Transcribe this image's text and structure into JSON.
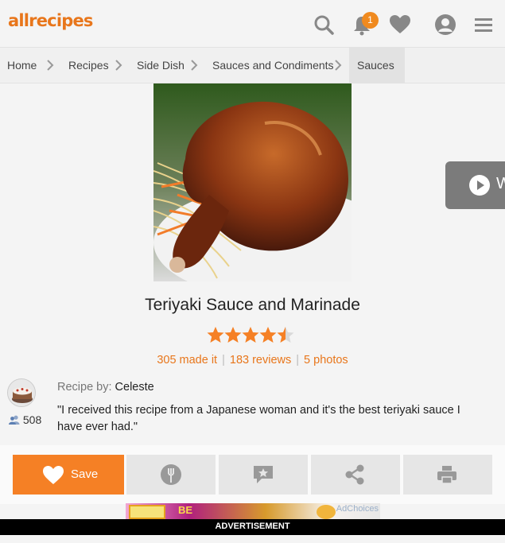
{
  "header": {
    "logo_text": "allrecipes",
    "notification_count": "1",
    "icons": [
      "search-icon",
      "bell-icon",
      "heart-icon",
      "user-icon",
      "hamburger-menu-icon"
    ]
  },
  "breadcrumb": {
    "items": [
      "Home",
      "Recipes",
      "Side Dish",
      "Sauces and Condiments",
      "Sauces"
    ]
  },
  "recipe": {
    "title": "Teriyaki Sauce and Marinade",
    "rating": 4.5,
    "made_it": "305 made it",
    "reviews": "183 reviews",
    "photos": "5 photos",
    "submitter_label": "Recipe by:",
    "submitter_name": "Celeste",
    "followers": "508",
    "description": "\"I received this recipe from a Japanese woman and it's the best teriyaki sauce I have ever had.\""
  },
  "actions": {
    "save_label": "Save",
    "icons": [
      "heart-icon",
      "made-it-icon",
      "review-icon",
      "share-icon",
      "print-icon"
    ]
  },
  "ad": {
    "choices_label": "AdChoices",
    "bar_label": "ADVERTISEMENT"
  },
  "colors": {
    "brand": "#f58025",
    "star": "#f58025"
  }
}
